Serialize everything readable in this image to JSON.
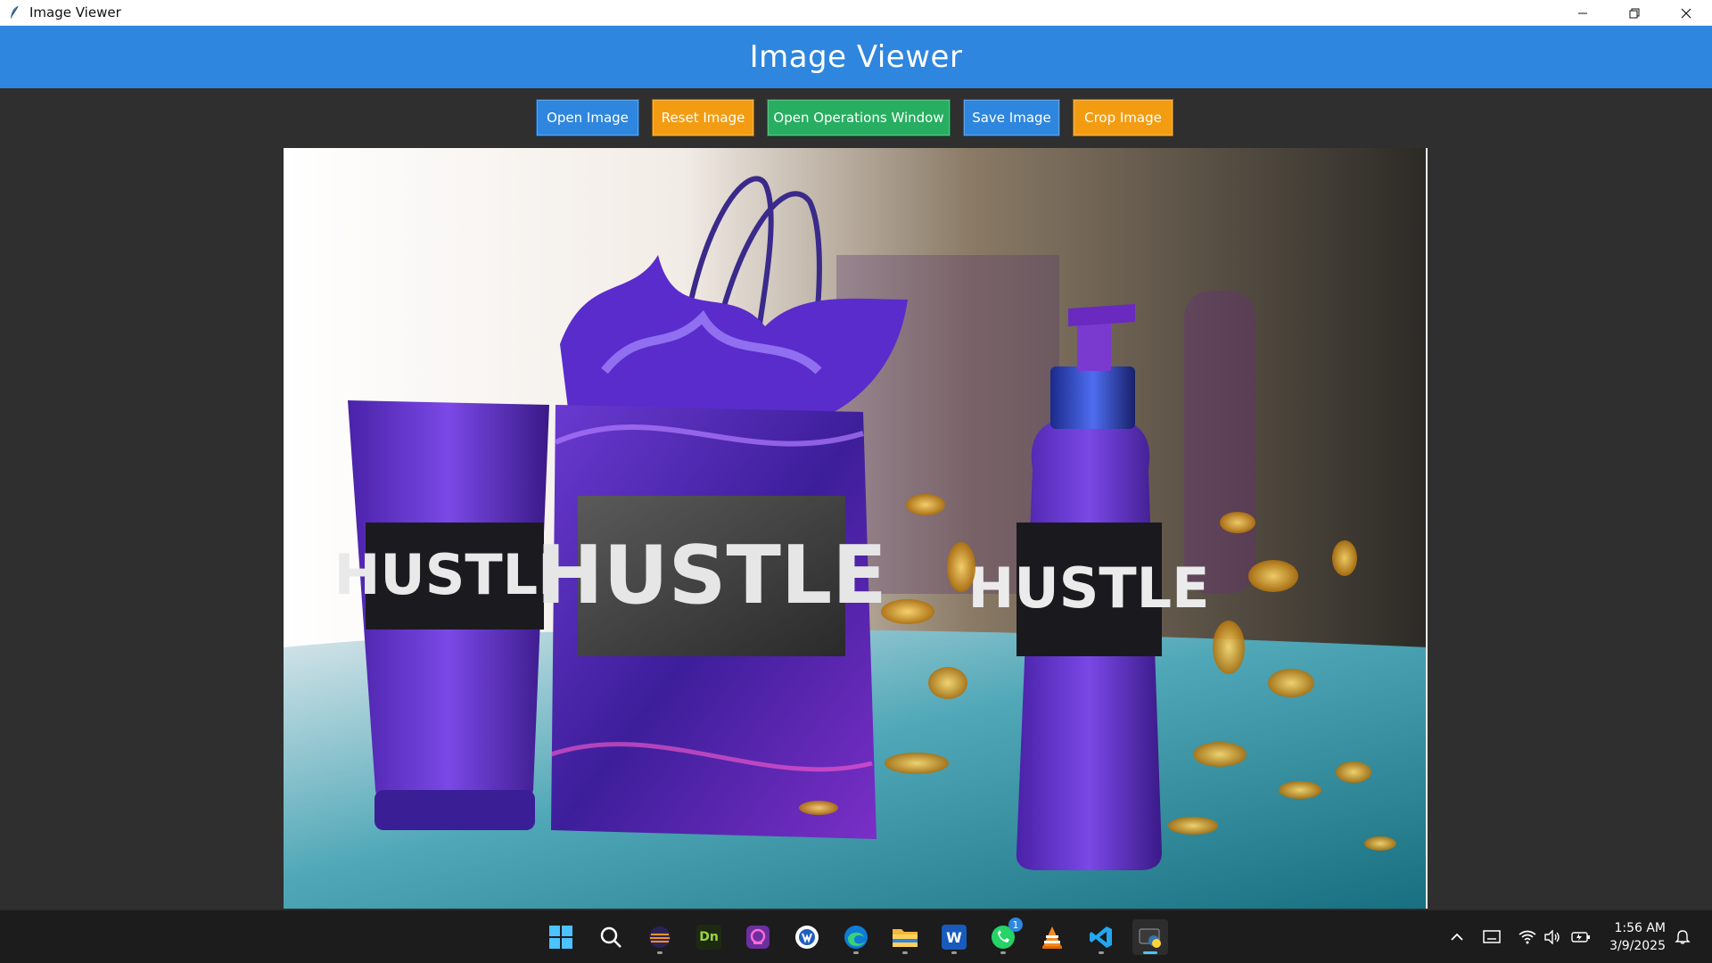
{
  "window": {
    "title": "Image Viewer",
    "controls": [
      "minimize",
      "restore",
      "close"
    ]
  },
  "header": {
    "title": "Image Viewer",
    "color": "#2e86de"
  },
  "toolbar": {
    "buttons": [
      {
        "label": "Open Image",
        "color": "#2e86de"
      },
      {
        "label": "Reset Image",
        "color": "#f39c12"
      },
      {
        "label": "Open Operations Window",
        "color": "#27ae60"
      },
      {
        "label": "Save Image",
        "color": "#2e86de"
      },
      {
        "label": "Crop Image",
        "color": "#f39c12"
      }
    ]
  },
  "image": {
    "product_text": "HUSTLE"
  },
  "taskbar": {
    "apps": [
      {
        "name": "start-icon"
      },
      {
        "name": "search-icon"
      },
      {
        "name": "eclipse-icon"
      },
      {
        "name": "dimension-icon",
        "text": "Dn"
      },
      {
        "name": "app-purple-icon"
      },
      {
        "name": "app-blue-circle-icon"
      },
      {
        "name": "edge-icon"
      },
      {
        "name": "file-explorer-icon"
      },
      {
        "name": "word-icon",
        "text": "W"
      },
      {
        "name": "whatsapp-icon",
        "badge": "1"
      },
      {
        "name": "vlc-icon"
      },
      {
        "name": "vscode-icon"
      },
      {
        "name": "python-app-icon",
        "active": true
      }
    ],
    "tray": [
      "chevron-up-icon",
      "display-icon",
      "wifi-icon",
      "volume-icon",
      "battery-icon",
      "notification-icon"
    ],
    "clock": {
      "time": "1:56 AM",
      "date": "3/9/2025"
    }
  }
}
